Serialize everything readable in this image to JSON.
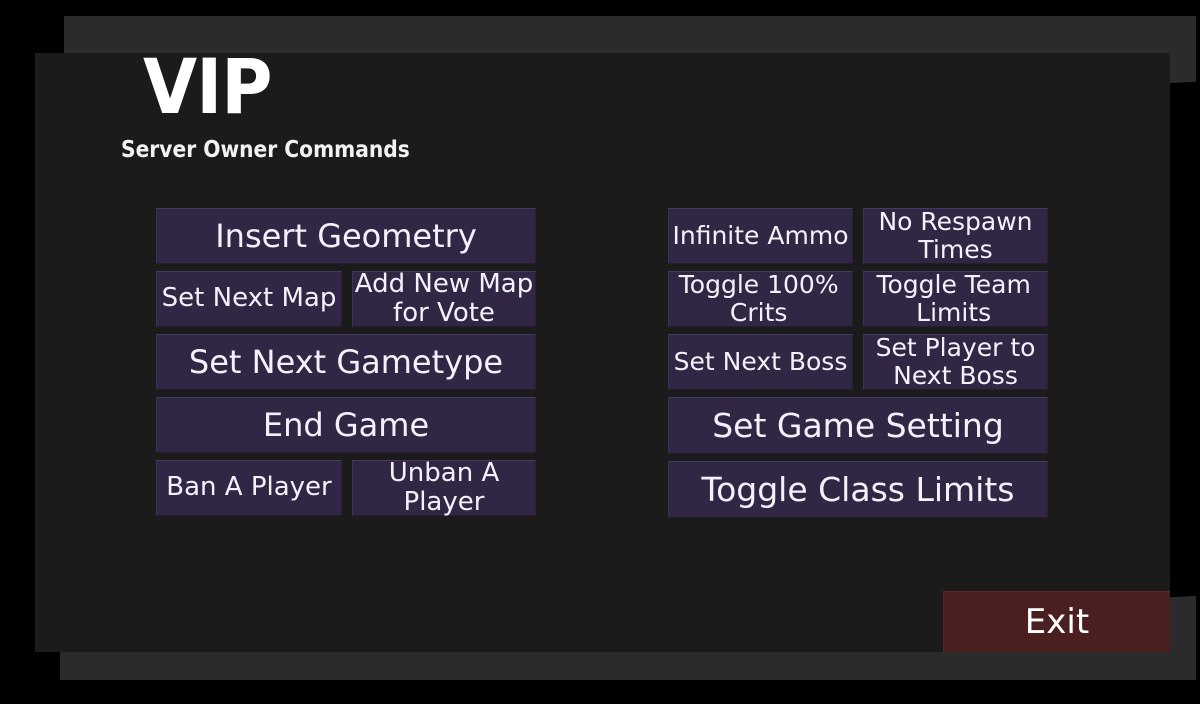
{
  "header": {
    "title": "VIP",
    "subtitle": "Server Owner Commands"
  },
  "colors": {
    "background": "#000000",
    "panel": "#1b1b1b",
    "backing_panel": "#2b2b2b",
    "button_fill": "#312745",
    "button_border": "#453962",
    "button_text": "#f4f1fa",
    "exit_fill": "#4a1f1f",
    "exit_text": "#ffffff",
    "title_text": "#ffffff"
  },
  "left_column": {
    "rows": [
      {
        "type": "full",
        "buttons": [
          {
            "label": "Insert Geometry"
          }
        ]
      },
      {
        "type": "split",
        "buttons": [
          {
            "label": "Set Next Map"
          },
          {
            "label": "Add New Map for Vote"
          }
        ]
      },
      {
        "type": "full",
        "buttons": [
          {
            "label": "Set Next Gametype"
          }
        ]
      },
      {
        "type": "full",
        "buttons": [
          {
            "label": "End Game"
          }
        ]
      },
      {
        "type": "split",
        "buttons": [
          {
            "label": "Ban A Player"
          },
          {
            "label": "Unban A Player"
          }
        ]
      }
    ]
  },
  "right_column": {
    "rows": [
      {
        "type": "split",
        "buttons": [
          {
            "label": "Infinite Ammo"
          },
          {
            "label": "No Respawn Times"
          }
        ]
      },
      {
        "type": "split",
        "buttons": [
          {
            "label": "Toggle 100% Crits"
          },
          {
            "label": "Toggle Team Limits"
          }
        ]
      },
      {
        "type": "split",
        "buttons": [
          {
            "label": "Set Next Boss"
          },
          {
            "label": "Set Player to Next Boss"
          }
        ]
      },
      {
        "type": "full",
        "buttons": [
          {
            "label": "Set Game Setting"
          }
        ]
      },
      {
        "type": "full",
        "buttons": [
          {
            "label": "Toggle Class Limits"
          }
        ]
      }
    ]
  },
  "footer": {
    "exit_label": "Exit"
  }
}
